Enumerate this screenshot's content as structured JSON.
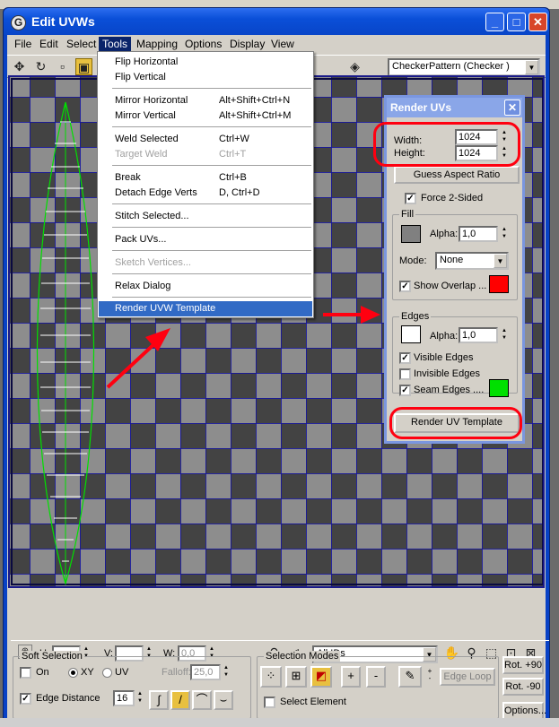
{
  "window": {
    "title": "Edit UVWs",
    "min": "_",
    "max": "□",
    "close": "✕"
  },
  "menubar": [
    "File",
    "Edit",
    "Select",
    "Tools",
    "Mapping",
    "Options",
    "Display",
    "View"
  ],
  "toolbar": {
    "uv_label": "UV",
    "map_combo": "CheckerPattern  (Checker )"
  },
  "tools_menu": {
    "items": [
      {
        "label": "Flip Horizontal",
        "shortcut": ""
      },
      {
        "label": "Flip Vertical",
        "shortcut": ""
      },
      {
        "label": "Mirror Horizontal",
        "shortcut": "Alt+Shift+Ctrl+N"
      },
      {
        "label": "Mirror Vertical",
        "shortcut": "Alt+Shift+Ctrl+M"
      },
      {
        "label": "Weld Selected",
        "shortcut": "Ctrl+W"
      },
      {
        "label": "Target Weld",
        "shortcut": "Ctrl+T"
      },
      {
        "label": "Break",
        "shortcut": "Ctrl+B"
      },
      {
        "label": "Detach Edge Verts",
        "shortcut": "D, Ctrl+D"
      },
      {
        "label": "Stitch Selected...",
        "shortcut": ""
      },
      {
        "label": "Pack UVs...",
        "shortcut": ""
      },
      {
        "label": "Sketch Vertices...",
        "shortcut": ""
      },
      {
        "label": "Relax Dialog",
        "shortcut": ""
      },
      {
        "label": "Render UVW Template",
        "shortcut": ""
      }
    ]
  },
  "render_uvs": {
    "title": "Render UVs",
    "width_label": "Width:",
    "width_value": "1024",
    "height_label": "Height:",
    "height_value": "1024",
    "guess_button": "Guess Aspect Ratio",
    "force_2sided": "Force 2-Sided",
    "fill_group": "Fill",
    "fill_color": "#808080",
    "alpha_label": "Alpha:",
    "fill_alpha": "1,0",
    "mode_label": "Mode:",
    "mode_value": "None",
    "show_overlap": "Show Overlap ...",
    "overlap_color": "#ff0000",
    "edges_group": "Edges",
    "edge_color": "#ffffff",
    "edge_alpha": "1,0",
    "visible_edges": "Visible Edges",
    "invisible_edges": "Invisible Edges",
    "seam_edges": "Seam Edges ....",
    "seam_color": "#00e000",
    "render_button": "Render UV Template"
  },
  "status": {
    "u_label": "U:",
    "v_label": "V:",
    "w_label": "W:",
    "w_value": "0,0",
    "ids_combo": "All IDs"
  },
  "soft_selection": {
    "title": "Soft Selection",
    "on_label": "On",
    "xy_label": "XY",
    "uv_label": "UV",
    "falloff_label": "Falloff:",
    "falloff_value": "25,0",
    "edge_distance_label": "Edge Distance",
    "edge_distance_value": "16"
  },
  "selection_modes": {
    "title": "Selection Modes",
    "plus": "+",
    "minus": "-",
    "edge_loop": "Edge Loop",
    "select_element": "Select Element"
  },
  "rotate": {
    "plus": "Rot. +90",
    "minus": "Rot. -90",
    "options": "Options..."
  },
  "colors": {
    "titlebar": "#0a4fd8",
    "highlight": "#316ac5",
    "annotation": "#ff0010",
    "uv_edges": "#00e000"
  }
}
